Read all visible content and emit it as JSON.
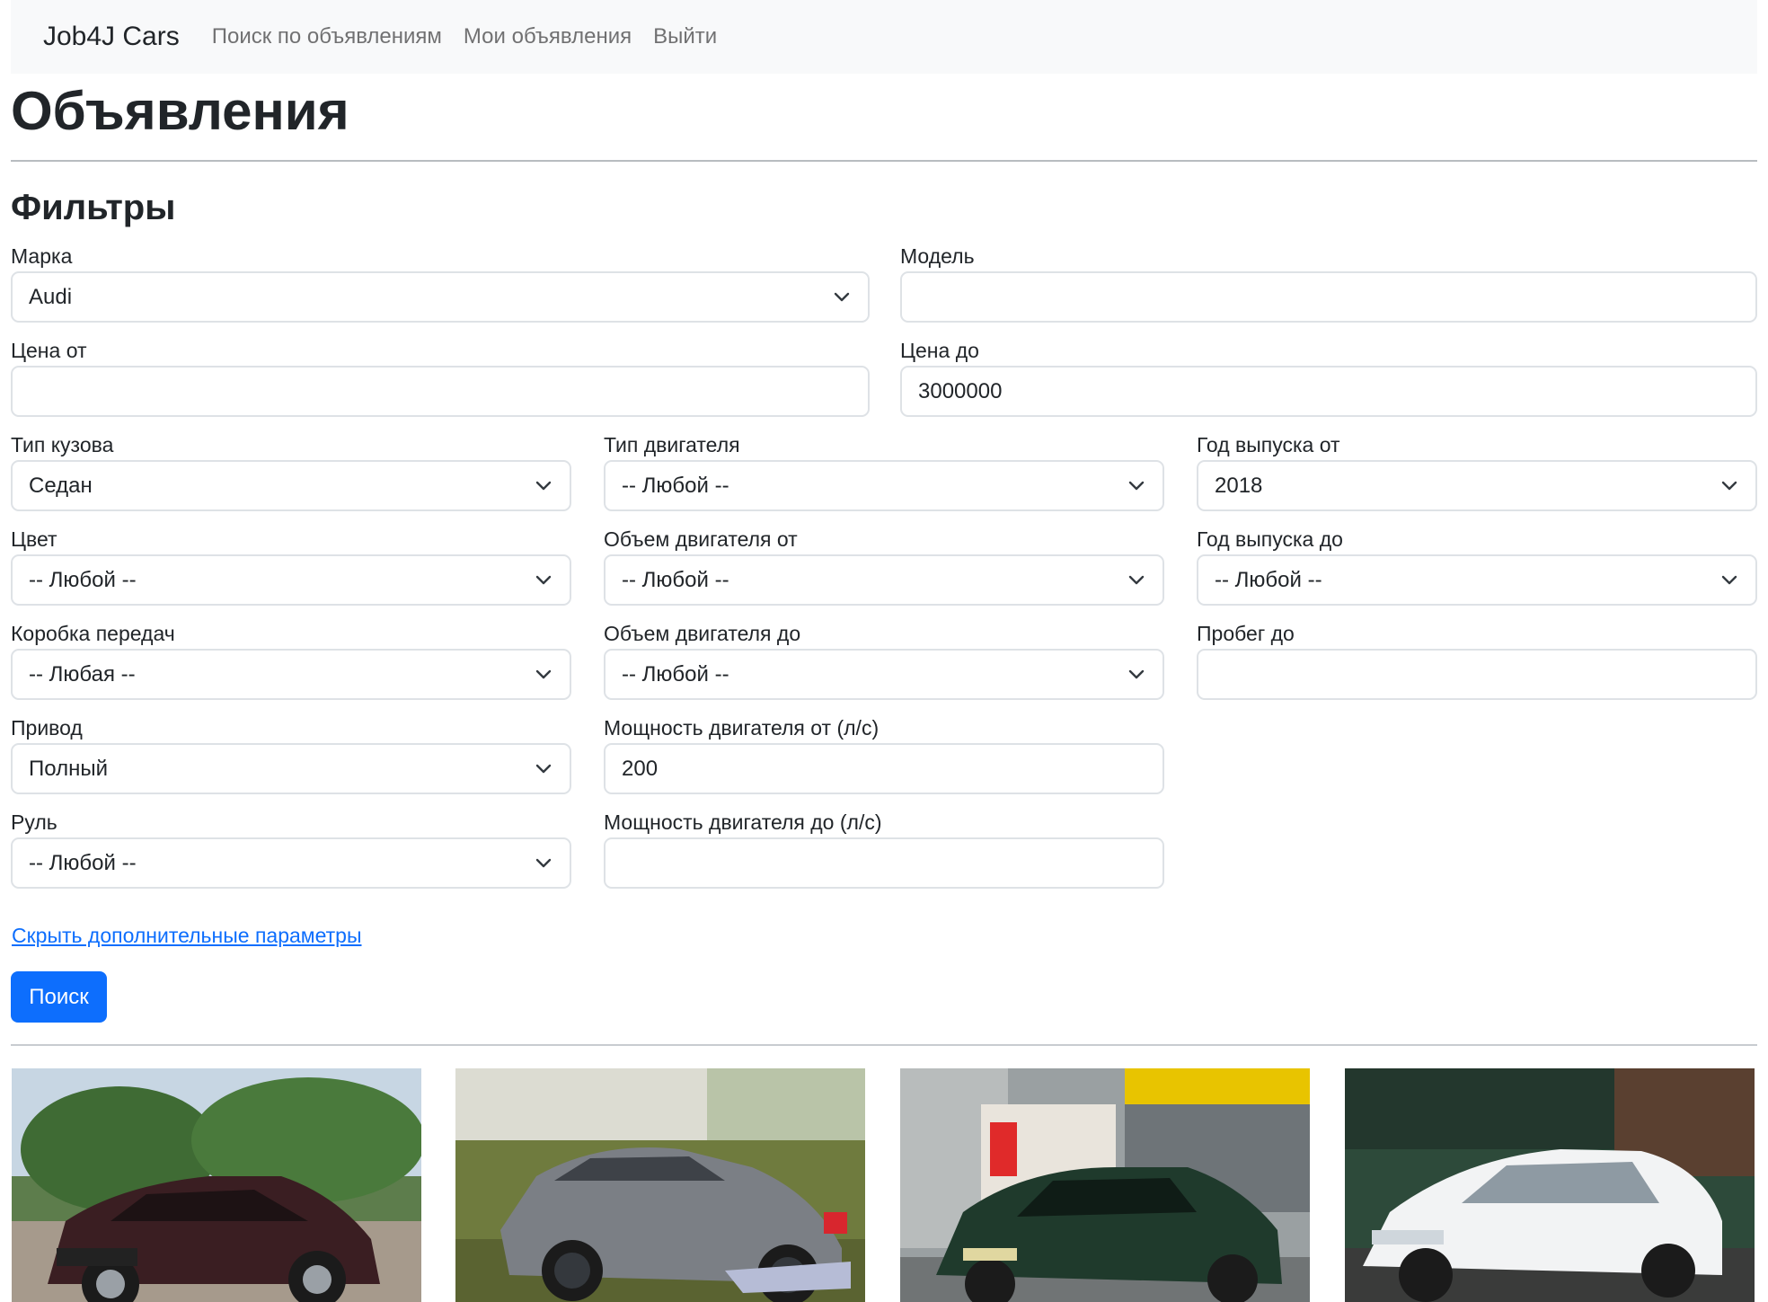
{
  "navbar": {
    "brand": "Job4J Cars",
    "links": [
      "Поиск по объявлениям",
      "Мои объявления",
      "Выйти"
    ]
  },
  "page_title": "Объявления",
  "filters": {
    "title": "Фильтры",
    "brand": {
      "label": "Марка",
      "value": "Audi"
    },
    "model": {
      "label": "Модель",
      "value": ""
    },
    "price_from": {
      "label": "Цена от",
      "value": ""
    },
    "price_to": {
      "label": "Цена до",
      "value": "3000000"
    },
    "body_type": {
      "label": "Тип кузова",
      "value": "Седан"
    },
    "engine_type": {
      "label": "Тип двигателя",
      "value": "-- Любой --"
    },
    "year_from": {
      "label": "Год выпуска от",
      "value": "2018"
    },
    "color": {
      "label": "Цвет",
      "value": "-- Любой --"
    },
    "engine_volume_from": {
      "label": "Объем двигателя от",
      "value": "-- Любой --"
    },
    "year_to": {
      "label": "Год выпуска до",
      "value": "-- Любой --"
    },
    "gearbox": {
      "label": "Коробка передач",
      "value": "-- Любая --"
    },
    "engine_volume_to": {
      "label": "Объем двигателя до",
      "value": "-- Любой --"
    },
    "mileage_to": {
      "label": "Пробег до",
      "value": ""
    },
    "drive": {
      "label": "Привод",
      "value": "Полный"
    },
    "power_from": {
      "label": "Мощность двигателя от (л/с)",
      "value": "200"
    },
    "steering": {
      "label": "Руль",
      "value": "-- Любой --"
    },
    "power_to": {
      "label": "Мощность двигателя до (л/с)",
      "value": ""
    },
    "hide_link": "Скрыть дополнительные параметры",
    "search_button": "Поиск"
  },
  "listings": [
    {
      "photo": "car-photo",
      "color": "#3a1e22"
    },
    {
      "photo": "car-photo",
      "color": "#7b7f85"
    },
    {
      "photo": "car-photo",
      "color": "#1f3a2c"
    },
    {
      "photo": "car-photo",
      "color": "#f2f3f4"
    }
  ],
  "colors": {
    "primary": "#0d6efd",
    "navbar_bg": "#f8f9fa",
    "border": "#dee2e6"
  }
}
